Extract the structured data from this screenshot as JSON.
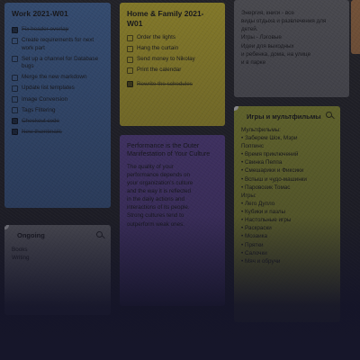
{
  "colors": {
    "background": "#2d2d30",
    "note_blue": "#4a6fa3",
    "note_yellow": "#c9b832",
    "note_purple": "#6a4fa0",
    "note_olive": "#a3a838",
    "note_gray": "#6b6b6e",
    "note_white": "#e4e4e4",
    "note_tan": "#b07a4a"
  },
  "notes": {
    "work": {
      "title": "Work 2021-W01",
      "items": [
        {
          "text": "Fix header overlap",
          "checked": true
        },
        {
          "text": "Create requirements for next work part",
          "checked": false
        },
        {
          "text": "Set up a channel for Database bugs",
          "checked": false
        },
        {
          "text": "Merge the new markdown",
          "checked": false
        },
        {
          "text": "Update list templates",
          "checked": false
        },
        {
          "text": "Image Conversion",
          "checked": false
        },
        {
          "text": "Tags Filtering",
          "checked": false
        },
        {
          "text": "Checkout code",
          "checked": true
        },
        {
          "text": "New thumbnails",
          "checked": true
        }
      ]
    },
    "home": {
      "title": "Home & Family 2021-W01",
      "items": [
        {
          "text": "Order the lights",
          "checked": false
        },
        {
          "text": "Hang the curtain",
          "checked": false
        },
        {
          "text": "Send money to Nikolay",
          "checked": false
        },
        {
          "text": "Print the calendar",
          "checked": false
        },
        {
          "text": "Rewrite the schedules",
          "checked": true
        }
      ]
    },
    "performance": {
      "title": "Performance is the Outer Manifestation of Your Culture",
      "lines": [
        "The quality of your",
        "performance depends on",
        "your organization's culture",
        "and the way it is reflected",
        "in the daily actions and",
        "interactions of its people.",
        "Strong cultures tend to",
        "outperform weak ones."
      ]
    },
    "entertainment": {
      "lines": [
        "Энергия, книги - все",
        "виды отдыха и развлечения для",
        "детей.",
        "Игры - Лэговые",
        "Идеи для выходных",
        "и ребенка, дома, на улице",
        "и в парке"
      ]
    },
    "games": {
      "title": "Игры и мультфильмы",
      "lines": [
        "Мультфильмы:",
        "• Заберем Шок, Мэри",
        "  Поппинс",
        "• Время приключений",
        "• Свинка Пеппа",
        "• Смешарики и Фиксики",
        "• Вспыш и чудо-машинки",
        "• Паровозик Томас",
        "Игры:",
        "• Лего Дупло",
        "• Кубики и пазлы",
        "• Настольные игры",
        "• Раскраски",
        "• Мозаика",
        "• Прятки",
        "• Салочки",
        "• Мяч и обручи"
      ]
    },
    "ongoing": {
      "title": "Ongoing",
      "lines": [
        "Books",
        "Writing"
      ]
    }
  }
}
